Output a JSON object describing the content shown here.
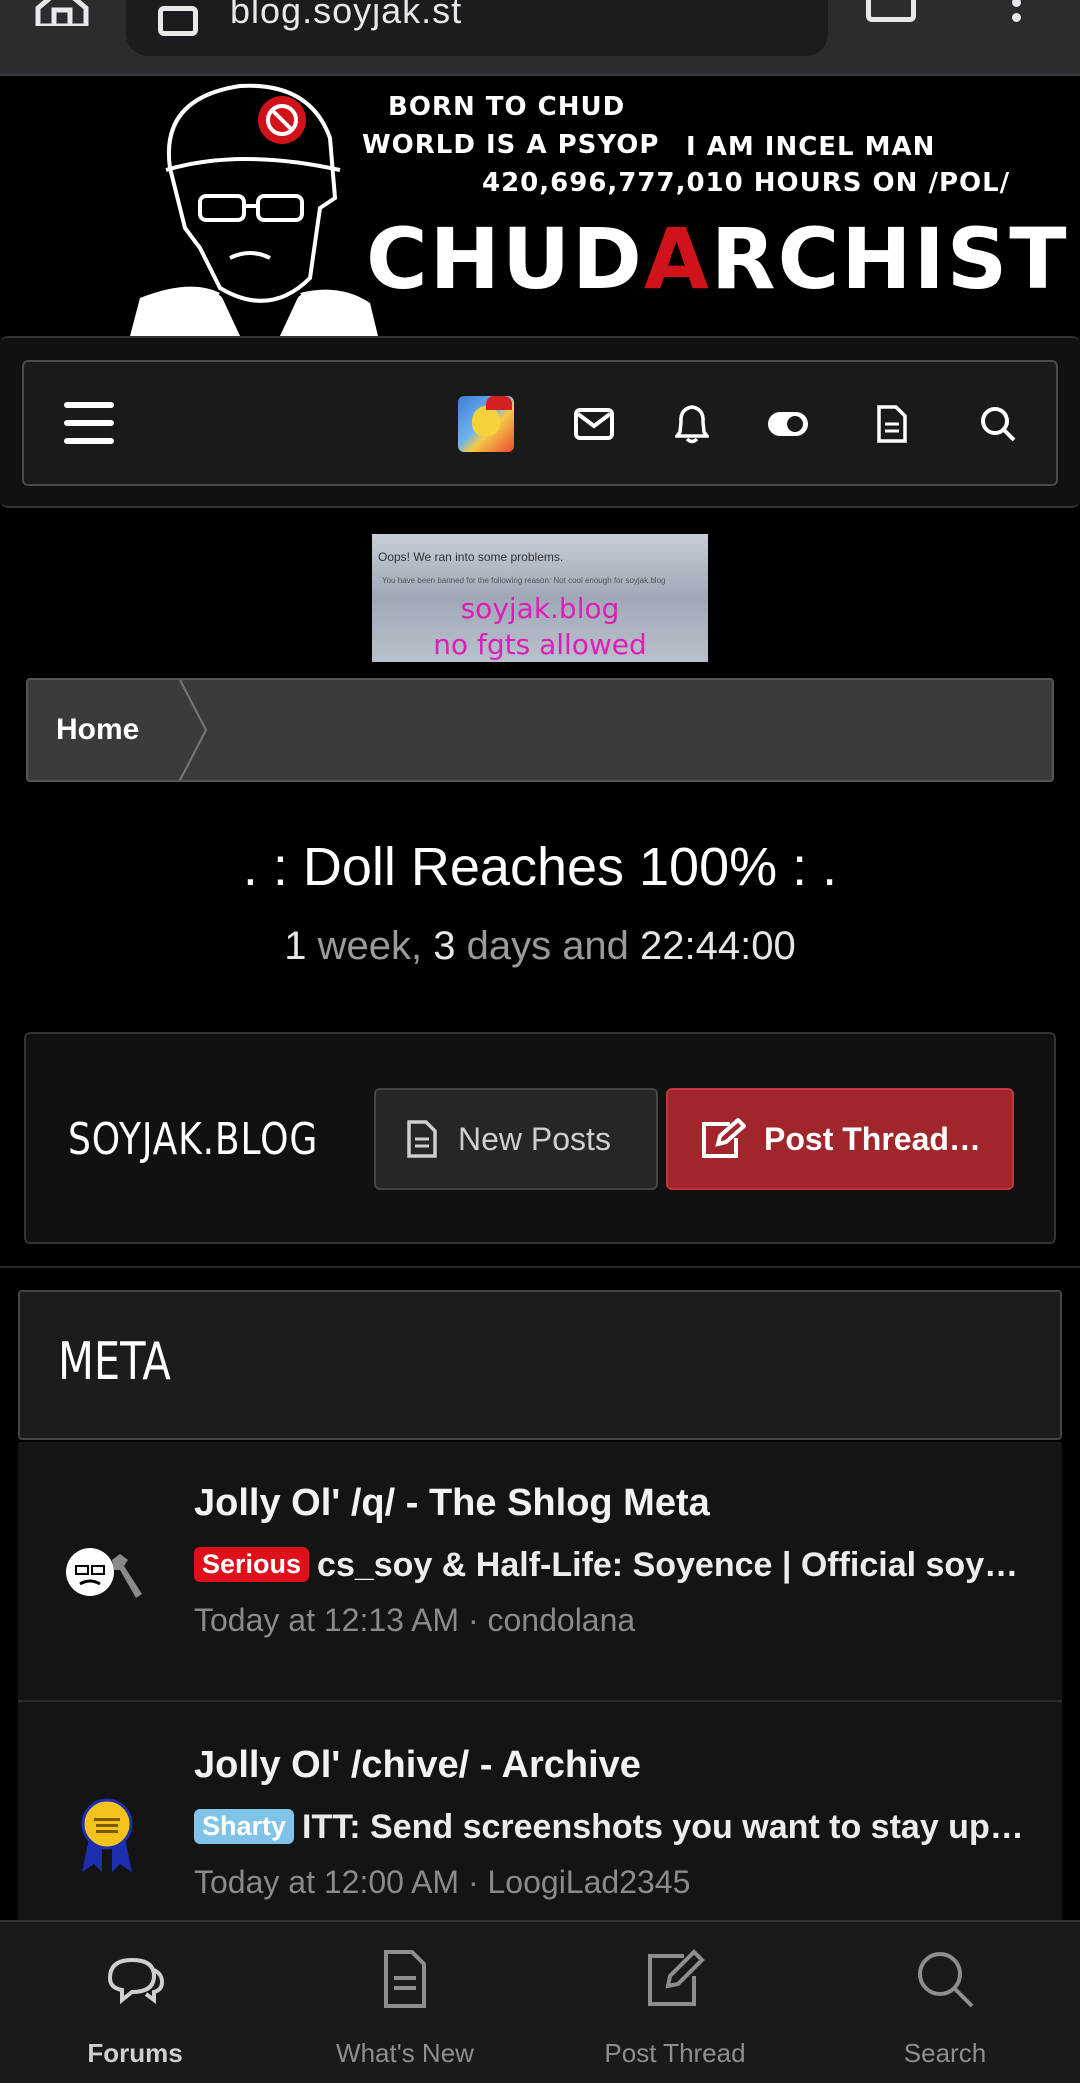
{
  "browser": {
    "url": "blog.soyjak.st"
  },
  "banner": {
    "line1": "BORN TO CHUD",
    "line2": "WORLD IS A PSYOP",
    "line2b": "I AM INCEL MAN",
    "line3": "420,696,777,010 HOURS ON /POL/",
    "brand_left": "CHUD",
    "brand_a": "A",
    "brand_right": "RCHIST"
  },
  "ad": {
    "oops": "Oops! We ran into some problems.",
    "banned": "You have been banned for the following reason: Not cool enough for soyjak.blog",
    "line1": "soyjak.blog",
    "line2": "no fgts allowed"
  },
  "breadcrumb": {
    "home": "Home"
  },
  "countdown": {
    "title": ". : Doll Reaches 100% : .",
    "weeks": "1",
    "weeks_word": " week, ",
    "days": "3",
    "days_word": " days and ",
    "clock": "22:44:00"
  },
  "forum_header": {
    "site_name": "SOYJAK.BLOG",
    "new_posts": "New Posts",
    "post_thread": "Post Thread…"
  },
  "category": {
    "title": "META"
  },
  "nodes": [
    {
      "name": "Jolly Ol' /q/ - The Shlog Meta",
      "prefix": "Serious",
      "latest": "cs_soy & Half-Life: Soyence | Official soyjak.blog server",
      "meta": "Today at 12:13 AM · condolana"
    },
    {
      "name": "Jolly Ol' /chive/ - Archive",
      "prefix": "Sharty",
      "latest": "ITT: Send screenshots you want to stay up forever",
      "meta": "Today at 12:00 AM · LoogiLad2345"
    }
  ],
  "tabbar": {
    "forums": "Forums",
    "whats_new": "What's New",
    "post_thread": "Post Thread",
    "search": "Search"
  },
  "colors": {
    "accent_red": "#a0262c",
    "serious": "#e0101b",
    "sharty": "#7fc4e8"
  }
}
